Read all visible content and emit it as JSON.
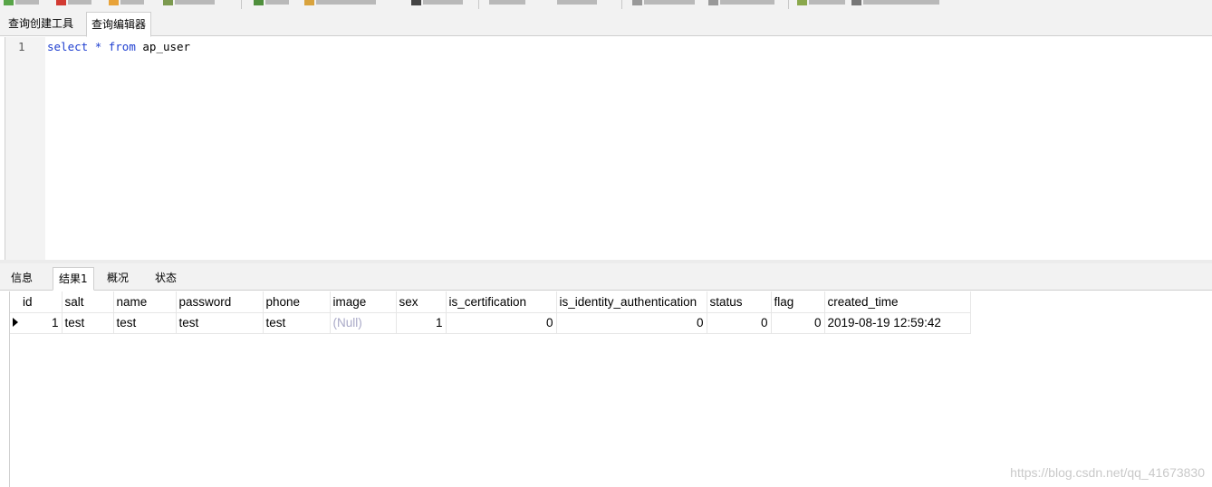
{
  "tabs": [
    "查询创建工具",
    "查询编辑器"
  ],
  "editor": {
    "line_number": "1",
    "tokens": [
      "select",
      "*",
      "from",
      "ap_user"
    ]
  },
  "result_tabs": [
    "信息",
    "结果1",
    "概况",
    "状态"
  ],
  "grid": {
    "columns": [
      "id",
      "salt",
      "name",
      "password",
      "phone",
      "image",
      "sex",
      "is_certification",
      "is_identity_authentication",
      "status",
      "flag",
      "created_time"
    ],
    "rows": [
      [
        "1",
        "test",
        "test",
        "test",
        "test",
        "(Null)",
        "1",
        "0",
        "0",
        "0",
        "0",
        "2019-08-19 12:59:42"
      ]
    ]
  },
  "watermark": "https://blog.csdn.net/qq_41673830",
  "colors": {
    "keyword": "#1f3fd0",
    "null_text": "#a9a9c7",
    "toolbar_bg": "#f2f2f2"
  }
}
